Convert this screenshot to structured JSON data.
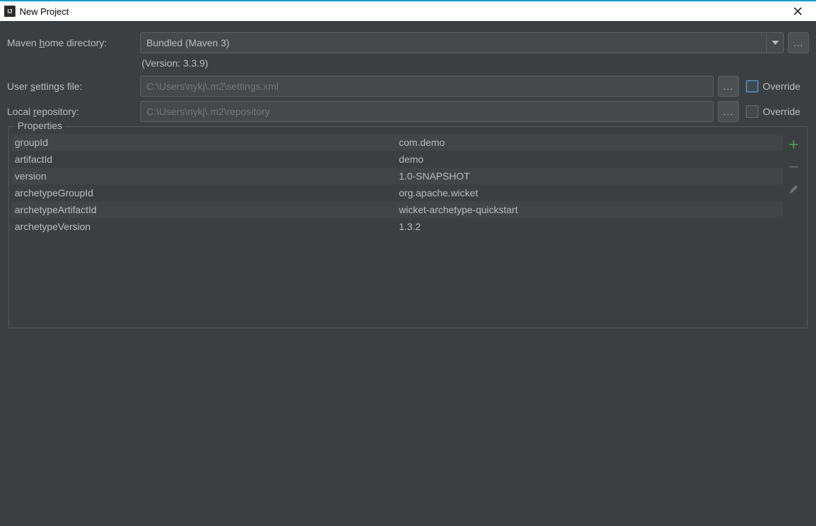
{
  "window": {
    "title": "New Project"
  },
  "form": {
    "maven_home_label_pre": "Maven ",
    "maven_home_label_u": "h",
    "maven_home_label_post": "ome directory:",
    "maven_home_value": "Bundled (Maven 3)",
    "version_text": "(Version: 3.3.9)",
    "user_settings_label_pre": "User ",
    "user_settings_label_u": "s",
    "user_settings_label_post": "ettings file:",
    "user_settings_value": "C:\\Users\\nykj\\.m2\\settings.xml",
    "local_repo_label_pre": "Local ",
    "local_repo_label_u": "r",
    "local_repo_label_post": "epository:",
    "local_repo_value": "C:\\Users\\nykj\\.m2\\repository",
    "override_label": "Override",
    "browse_label": "..."
  },
  "properties": {
    "legend": "Properties",
    "rows": [
      {
        "key": "groupId",
        "value": "com.demo"
      },
      {
        "key": "artifactId",
        "value": "demo"
      },
      {
        "key": "version",
        "value": "1.0-SNAPSHOT"
      },
      {
        "key": "archetypeGroupId",
        "value": "org.apache.wicket"
      },
      {
        "key": "archetypeArtifactId",
        "value": "wicket-archetype-quickstart"
      },
      {
        "key": "archetypeVersion",
        "value": "1.3.2"
      }
    ]
  }
}
